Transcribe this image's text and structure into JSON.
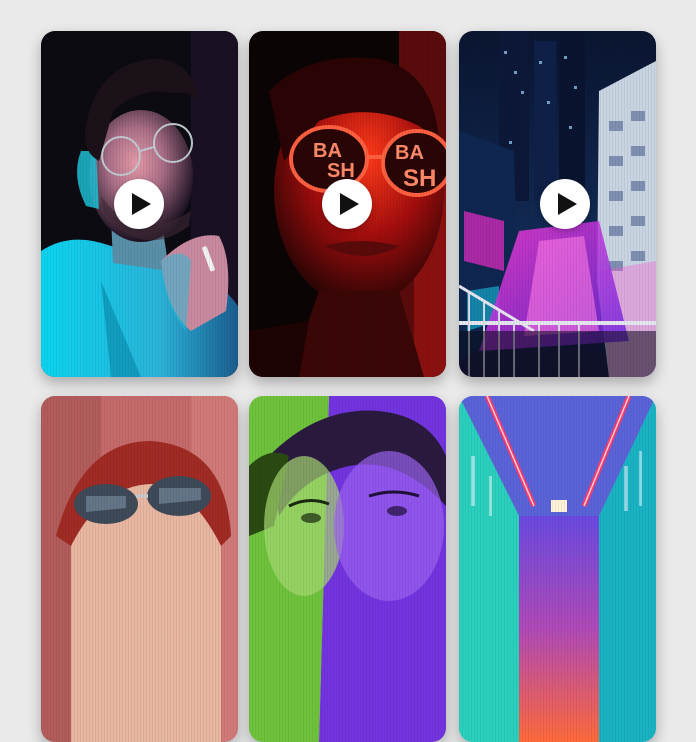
{
  "gallery": {
    "accent_play_color": "#111111",
    "play_bg": "#ffffff",
    "items": [
      {
        "name": "man-cigarette-neon",
        "has_play": true,
        "colors": [
          "#07c9e6",
          "#1a1530",
          "#d21c78"
        ]
      },
      {
        "name": "red-neon-glasses",
        "has_play": true,
        "colors": [
          "#e01010",
          "#3a0505",
          "#ff6a3a"
        ]
      },
      {
        "name": "city-alley-night",
        "has_play": true,
        "colors": [
          "#0a1a3a",
          "#ff2bd1",
          "#11d0f0"
        ]
      },
      {
        "name": "red-hair-sunglasses",
        "has_play": false,
        "colors": [
          "#b04a4a",
          "#d06060",
          "#3a2a35"
        ]
      },
      {
        "name": "green-purple-portrait",
        "has_play": false,
        "colors": [
          "#74c640",
          "#7b37e6",
          "#d8d0f0"
        ]
      },
      {
        "name": "neon-corridor",
        "has_play": false,
        "colors": [
          "#1fc5b5",
          "#ff3b6b",
          "#5a3ad8"
        ]
      }
    ]
  }
}
